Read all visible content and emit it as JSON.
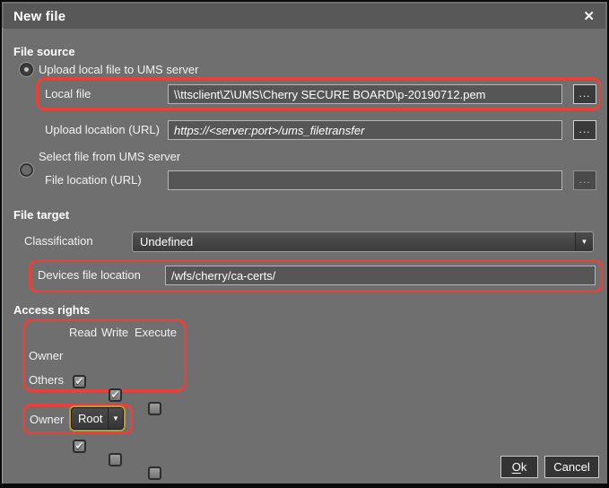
{
  "dialog": {
    "title": "New file",
    "close_glyph": "✕"
  },
  "file_source": {
    "header": "File source",
    "upload_radio": {
      "label": "Upload local file to UMS server",
      "selected": true
    },
    "local_file": {
      "label": "Local file",
      "value": "\\\\ttsclient\\Z\\UMS\\Cherry SECURE BOARD\\p-20190712.pem",
      "browse_label": "..."
    },
    "upload_location": {
      "label": "Upload location (URL)",
      "value": "https://<server:port>/ums_filetransfer",
      "browse_label": "..."
    },
    "select_radio": {
      "label": "Select file from UMS server",
      "selected": false
    },
    "file_location": {
      "label": "File location (URL)",
      "value": "",
      "browse_label": "..."
    }
  },
  "file_target": {
    "header": "File target",
    "classification": {
      "label": "Classification",
      "value": "Undefined",
      "dropdown_glyph": "▼"
    },
    "devices_file_location": {
      "label": "Devices file location",
      "value": "/wfs/cherry/ca-certs/"
    }
  },
  "access_rights": {
    "header": "Access rights",
    "columns": [
      "Read",
      "Write",
      "Execute"
    ],
    "rows": [
      {
        "label": "Owner",
        "read": true,
        "write": true,
        "execute": false
      },
      {
        "label": "Others",
        "read": true,
        "write": false,
        "execute": false
      }
    ]
  },
  "owner_select": {
    "label": "Owner",
    "value": "Root",
    "dropdown_glyph": "▼"
  },
  "buttons": {
    "ok_label": "Ok",
    "cancel_label": "Cancel"
  },
  "annotation": {
    "color": "#e8413a"
  }
}
